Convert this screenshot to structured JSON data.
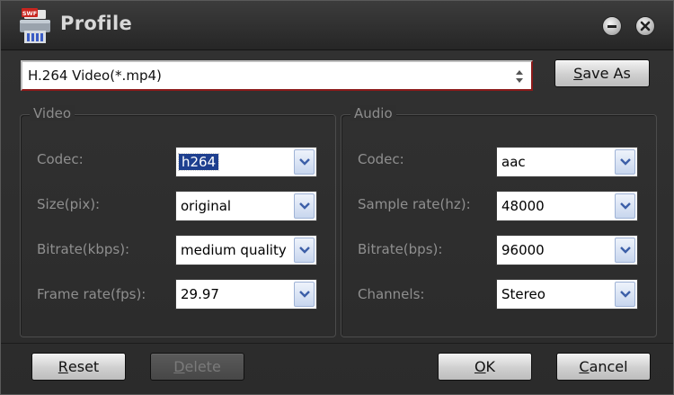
{
  "window": {
    "title": "Profile",
    "app_icon_text": "SWF"
  },
  "profile": {
    "value": "H.264 Video(*.mp4)",
    "save_as": {
      "label_u": "S",
      "label_rest": "ave As"
    }
  },
  "video": {
    "title": "Video",
    "fields": [
      {
        "label": "Codec:",
        "value": "h264"
      },
      {
        "label": "Size(pix):",
        "value": "original"
      },
      {
        "label": "Bitrate(kbps):",
        "value": "medium quality"
      },
      {
        "label": "Frame rate(fps):",
        "value": "29.97"
      }
    ]
  },
  "audio": {
    "title": "Audio",
    "fields": [
      {
        "label": "Codec:",
        "value": "aac"
      },
      {
        "label": "Sample rate(hz):",
        "value": "48000"
      },
      {
        "label": "Bitrate(bps):",
        "value": "96000"
      },
      {
        "label": "Channels:",
        "value": "Stereo"
      }
    ]
  },
  "buttons": {
    "reset": {
      "u": "R",
      "rest": "eset"
    },
    "delete": {
      "u": "D",
      "rest": "elete"
    },
    "ok": {
      "u": "O",
      "rest": "K"
    },
    "cancel": {
      "u": "C",
      "rest": "ancel"
    }
  },
  "colors": {
    "accent_red": "#8b1a1a",
    "selection": "#1e3f8f",
    "arrow_blue": "#3d5fa8"
  },
  "icons": {
    "app": "app-printer-icon",
    "minimize": "minimize-icon",
    "close": "close-icon",
    "dropdown": "chevron-down-icon",
    "spinner": "up-down-arrows-icon"
  }
}
